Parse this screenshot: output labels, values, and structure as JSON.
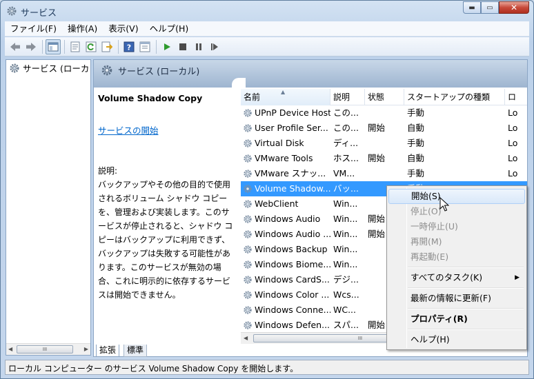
{
  "window": {
    "title": "サービス",
    "buttons": {
      "minimize": "▬",
      "maximize": "▭",
      "close": "✕"
    }
  },
  "menu": [
    "ファイル(F)",
    "操作(A)",
    "表示(V)",
    "ヘルプ(H)"
  ],
  "toolbar": {
    "icons": [
      "back-arrow-icon",
      "forward-arrow-icon",
      "console-tree-icon",
      "properties-icon",
      "refresh-icon",
      "export-list-icon",
      "help-icon",
      "view-icon",
      "start-icon",
      "stop-icon",
      "pause-icon",
      "restart-icon"
    ]
  },
  "tree": {
    "root_label": "サービス (ローカ"
  },
  "main": {
    "header": "サービス (ローカル)",
    "selected_service": "Volume Shadow Copy",
    "start_link": "サービスの開始",
    "description_label": "説明:",
    "description_text": "バックアップやその他の目的で使用されるボリューム シャドウ コピーを、管理および実装します。このサービスが停止されると、シャドウ コピーはバックアップに利用できず、バックアップは失敗する可能性があります。このサービスが無効の場合、これに明示的に依存するサービスは開始できません。",
    "columns": [
      "名前",
      "説明",
      "状態",
      "スタートアップの種類",
      "ロ"
    ],
    "services": [
      {
        "name": "UPnP Device Host",
        "desc": "この...",
        "status": "",
        "startup": "手動",
        "logon": "Lo"
      },
      {
        "name": "User Profile Ser...",
        "desc": "この...",
        "status": "開始",
        "startup": "自動",
        "logon": "Lo"
      },
      {
        "name": "Virtual Disk",
        "desc": "ディ...",
        "status": "",
        "startup": "手動",
        "logon": "Lo"
      },
      {
        "name": "VMware Tools",
        "desc": "ホス...",
        "status": "開始",
        "startup": "自動",
        "logon": "Lo"
      },
      {
        "name": "VMware スナッ...",
        "desc": "VM...",
        "status": "",
        "startup": "手動",
        "logon": "Lo"
      },
      {
        "name": "Volume Shadow...",
        "desc": "バッ...",
        "status": "",
        "startup": "手動",
        "logon": "Lo"
      },
      {
        "name": "WebClient",
        "desc": "Win...",
        "status": "",
        "startup": "",
        "logon": ""
      },
      {
        "name": "Windows Audio",
        "desc": "Win...",
        "status": "開始",
        "startup": "",
        "logon": ""
      },
      {
        "name": "Windows Audio ...",
        "desc": "Win...",
        "status": "開始",
        "startup": "",
        "logon": ""
      },
      {
        "name": "Windows Backup",
        "desc": "Win...",
        "status": "",
        "startup": "",
        "logon": ""
      },
      {
        "name": "Windows Biome...",
        "desc": "Win...",
        "status": "",
        "startup": "",
        "logon": ""
      },
      {
        "name": "Windows CardS...",
        "desc": "デジ...",
        "status": "",
        "startup": "",
        "logon": ""
      },
      {
        "name": "Windows Color ...",
        "desc": "Wcs...",
        "status": "",
        "startup": "",
        "logon": ""
      },
      {
        "name": "Windows Conne...",
        "desc": "WC...",
        "status": "",
        "startup": "",
        "logon": ""
      },
      {
        "name": "Windows Defen...",
        "desc": "スパ...",
        "status": "開始",
        "startup": "",
        "logon": ""
      }
    ],
    "scroll_grip": "III"
  },
  "tabs": {
    "extended": "拡張",
    "standard": "標準"
  },
  "status_bar": "ローカル コンピューター のサービス Volume Shadow Copy を開始します。",
  "context_menu": {
    "start": "開始(S)",
    "stop": "停止(O)",
    "pause": "一時停止(U)",
    "resume": "再開(M)",
    "restart": "再起動(E)",
    "all_tasks": "すべてのタスク(K)",
    "refresh": "最新の情報に更新(F)",
    "properties": "プロパティ(R)",
    "help": "ヘルプ(H)"
  },
  "colors": {
    "selection": "#3399ff",
    "link": "#0066cc",
    "header_gradient": "#9eb5d0"
  }
}
